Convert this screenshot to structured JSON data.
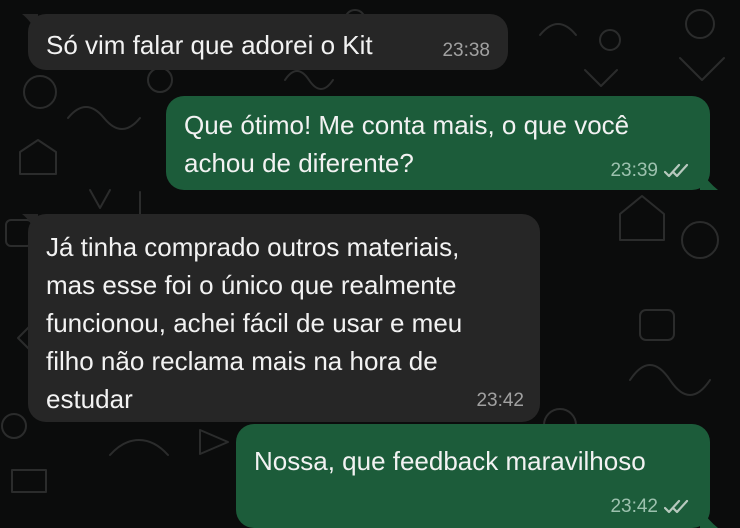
{
  "messages": [
    {
      "direction": "incoming",
      "text": "Só vim falar que adorei o Kit",
      "time": "23:38"
    },
    {
      "direction": "outgoing",
      "text": "Que ótimo! Me conta mais, o que você\nachou de diferente?",
      "time": "23:39",
      "status_icon": "double-check-icon"
    },
    {
      "direction": "incoming",
      "text": "Já tinha comprado outros materiais,\nmas esse foi o único que realmente\nfuncionou, achei fácil de usar e meu\nfilho não reclama mais na hora de\nestudar",
      "time": "23:42"
    },
    {
      "direction": "outgoing",
      "text": "Nossa, que feedback maravilhoso",
      "time": "23:42",
      "status_icon": "double-check-icon"
    }
  ],
  "colors": {
    "background": "#0b0c0c",
    "incoming_bubble": "#262626",
    "outgoing_bubble": "#1c5c3a",
    "text": "#f2f2f2",
    "meta_text": "#a8a8a8"
  }
}
